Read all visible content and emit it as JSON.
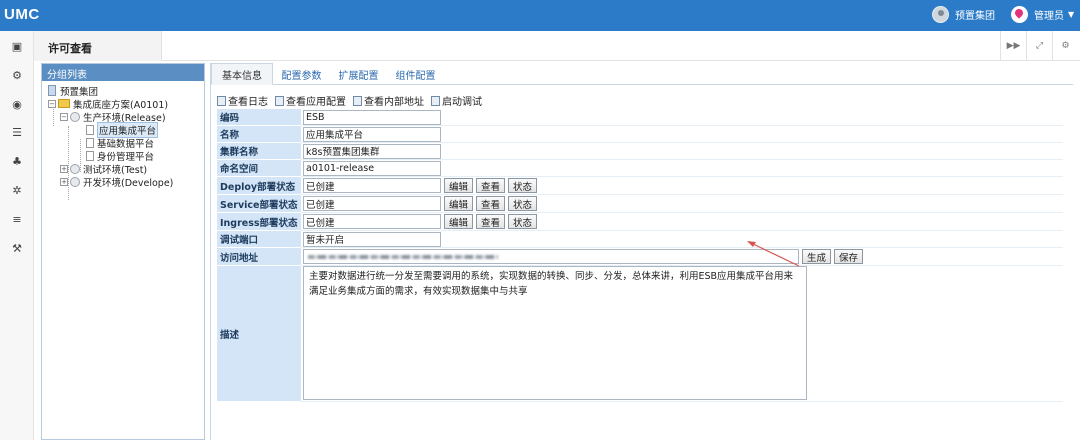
{
  "app": {
    "title": "UMC"
  },
  "topbar": {
    "group_label": "预置集团",
    "admin_label": "管理员",
    "group_icon": "building-avatar-icon",
    "admin_icon": "location-pin-icon"
  },
  "tabs": {
    "active": "许可查看"
  },
  "group_panel": {
    "title": "分组列表",
    "tree": [
      {
        "label": "预置集团"
      },
      {
        "label": "集成底座方案(A0101)"
      },
      {
        "label": "生产环境(Release)"
      },
      {
        "label": "应用集成平台"
      },
      {
        "label": "基础数据平台"
      },
      {
        "label": "身份管理平台"
      },
      {
        "label": "测试环境(Test)"
      },
      {
        "label": "开发环境(Develope)"
      }
    ]
  },
  "subtabs": [
    "基本信息",
    "配置参数",
    "扩展配置",
    "组件配置"
  ],
  "toolbar": [
    "查看日志",
    "查看应用配置",
    "查看内部地址",
    "启动调试"
  ],
  "form": {
    "code": {
      "label": "编码",
      "value": "ESB"
    },
    "name": {
      "label": "名称",
      "value": "应用集成平台"
    },
    "cluster": {
      "label": "集群名称",
      "value": "k8s预置集团集群"
    },
    "namespace": {
      "label": "命名空间",
      "value": "a0101-release"
    },
    "deploy": {
      "label": "Deploy部署状态",
      "value": "已创建"
    },
    "service": {
      "label": "Service部署状态",
      "value": "已创建"
    },
    "ingress": {
      "label": "Ingress部署状态",
      "value": "已创建"
    },
    "debug_port": {
      "label": "调试端口",
      "value": "暂未开启"
    },
    "access": {
      "label": "访问地址"
    },
    "desc": {
      "label": "描述",
      "value": "主要对数据进行统一分发至需要调用的系统，实现数据的转换、同步、分发，总体来讲，利用ESB应用集成平台用来满足业务集成方面的需求，有效实现数据集中与共享"
    },
    "buttons": {
      "edit": "编辑",
      "view": "查看",
      "status": "状态",
      "generate": "生成",
      "save": "保存"
    }
  },
  "colors": {
    "header_bg": "#2c7bc8",
    "label_bg": "#d3e5f7",
    "arrow": "#d9534f"
  }
}
